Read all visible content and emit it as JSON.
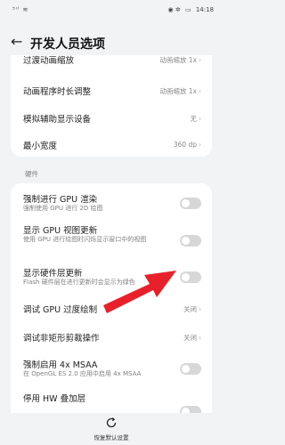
{
  "status_bar": {
    "left": "⁵ᴵˡ ≋",
    "right_icons": "◉ ✲",
    "battery": "▭",
    "time": "14:18"
  },
  "header": {
    "title": "开发人员选项"
  },
  "top_group": {
    "partial_title": "过渡动画缩放",
    "partial_value": "动画缩放 1x",
    "rows": [
      {
        "title": "动画程序时长调整",
        "value": "动画缩放 1x"
      },
      {
        "title": "模拟辅助显示设备",
        "value": "无"
      },
      {
        "title": "最小宽度",
        "value": "360 dp"
      }
    ]
  },
  "hardware": {
    "section_label": "硬件",
    "rows": [
      {
        "title": "强制进行 GPU 渲染",
        "subtitle": "强制使用 GPU 进行 2D 绘图"
      },
      {
        "title": "显示 GPU 视图更新",
        "subtitle": "使用 GPU 进行绘图时闪烁显示窗口中的视图"
      },
      {
        "title": "显示硬件层更新",
        "subtitle": "Flash 硬件层在进行更新时会显示为绿色"
      },
      {
        "title": "调试 GPU 过度绘制",
        "value": "关闭"
      },
      {
        "title": "调试非矩形剪裁操作",
        "value": "关闭"
      },
      {
        "title": "强制启用 4x MSAA",
        "subtitle": "在 OpenGL ES 2.0 应用中启用 4x MSAA"
      },
      {
        "title": "停用 HW 叠加层"
      }
    ]
  },
  "bottom": {
    "reset_label": "恢复默认设置"
  },
  "icons": {
    "back": "back-arrow-icon",
    "chevron": "chevron-right-icon",
    "reset": "reset-icon"
  },
  "colors": {
    "arrow": "#e8202a",
    "toggle_off": "#d7d7d7",
    "background": "#f1f3f5"
  }
}
